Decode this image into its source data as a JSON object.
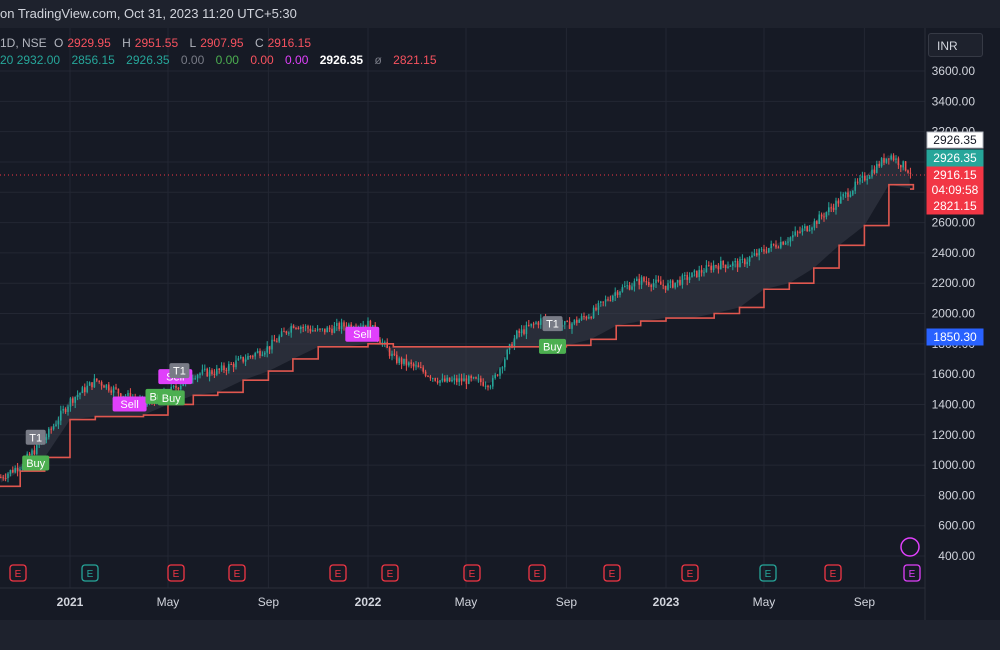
{
  "header": {
    "source_text": "on TradingView.com, Oct 31, 2023 11:20 UTC+5:30"
  },
  "legend": {
    "symbol": "1D, NSE",
    "o_label": "O",
    "o_val": "2929.95",
    "h_label": "H",
    "h_val": "2951.55",
    "l_label": "L",
    "l_val": "2907.95",
    "c_label": "C",
    "c_val": "2916.15",
    "ind_prefix": "20",
    "ind_values": [
      "2932.00",
      "2856.15",
      "2926.35",
      "0.00",
      "0.00",
      "0.00",
      "0.00",
      "2926.35",
      "2821.15"
    ],
    "ind_sep": "ø"
  },
  "price_axis": {
    "currency": "INR"
  },
  "price_tags": {
    "white": "2926.35",
    "green": "2926.35",
    "last_price": "2916.15",
    "countdown": "04:09:58",
    "stop": "2821.15",
    "blue": "1850.30"
  },
  "colors": {
    "bg": "#161a25",
    "grid": "#232733",
    "up": "#26a69a",
    "down": "#ef5350",
    "trail": "#e0574f",
    "label_buy": "#4caf50",
    "label_sell": "#e040fb",
    "label_t1": "#787b86",
    "blue_tag": "#2962ff"
  },
  "chart_data": {
    "type": "line",
    "description_series": "daily candlesticks with red trailing stop line and shaded band",
    "x": [
      "2020-10-01",
      "2020-11-01",
      "2020-12-01",
      "2021-01-01",
      "2021-02-01",
      "2021-03-01",
      "2021-04-01",
      "2021-05-01",
      "2021-06-01",
      "2021-07-01",
      "2021-08-01",
      "2021-09-01",
      "2021-10-01",
      "2021-11-01",
      "2021-12-01",
      "2022-01-01",
      "2022-02-01",
      "2022-03-01",
      "2022-04-01",
      "2022-05-01",
      "2022-06-01",
      "2022-07-01",
      "2022-08-01",
      "2022-09-01",
      "2022-10-01",
      "2022-11-01",
      "2022-12-01",
      "2023-01-01",
      "2023-02-01",
      "2023-03-01",
      "2023-04-01",
      "2023-05-01",
      "2023-06-01",
      "2023-07-01",
      "2023-08-01",
      "2023-09-01",
      "2023-10-01",
      "2023-10-31"
    ],
    "series": [
      {
        "values": [
          900,
          1000,
          1180,
          1430,
          1560,
          1480,
          1400,
          1480,
          1600,
          1620,
          1700,
          1780,
          1930,
          1880,
          1920,
          1930,
          1700,
          1640,
          1550,
          1560,
          1540,
          1860,
          1960,
          1920,
          2000,
          2150,
          2220,
          2180,
          2250,
          2320,
          2330,
          2420,
          2500,
          2600,
          2750,
          2900,
          3050,
          2916
        ]
      },
      {
        "values": [
          860,
          960,
          1050,
          1300,
          1320,
          1320,
          1330,
          1400,
          1460,
          1480,
          1560,
          1620,
          1700,
          1780,
          1780,
          1800,
          1780,
          1780,
          1780,
          1780,
          1780,
          1780,
          1780,
          1790,
          1830,
          1920,
          1950,
          1970,
          1970,
          2000,
          2040,
          2160,
          2200,
          2300,
          2450,
          2580,
          2850,
          2821
        ]
      }
    ],
    "ylim": [
      300,
      3720
    ],
    "y_ticks": [
      "3600.00",
      "3400.00",
      "3200.00",
      "3000.00",
      "2800.00",
      "2600.00",
      "2400.00",
      "2200.00",
      "2000.00",
      "1800.00",
      "1600.00",
      "1400.00",
      "1200.00",
      "1000.00",
      "800.00",
      "600.00",
      "400.00"
    ],
    "x_ticks": [
      "2021",
      "May",
      "Sep",
      "2022",
      "May",
      "Sep",
      "2023",
      "May",
      "Sep"
    ],
    "signals": [
      {
        "text": "T1",
        "x": "2020-11-20",
        "y": 1180
      },
      {
        "text": "Buy",
        "x": "2020-11-20",
        "y": 1010
      },
      {
        "text": "Sell",
        "x": "2021-03-15",
        "y": 1400
      },
      {
        "text": "Buy",
        "x": "2021-04-20",
        "y": 1450
      },
      {
        "text": "Buy",
        "x": "2021-05-05",
        "y": 1440
      },
      {
        "text": "Sell",
        "x": "2021-05-10",
        "y": 1580
      },
      {
        "text": "T1",
        "x": "2021-05-15",
        "y": 1620
      },
      {
        "text": "Sell",
        "x": "2021-12-25",
        "y": 1860
      },
      {
        "text": "T1",
        "x": "2022-08-15",
        "y": 1930
      },
      {
        "text": "Buy",
        "x": "2022-08-15",
        "y": 1780
      }
    ],
    "earnings_markers": [
      "E",
      "E",
      "E",
      "E",
      "E",
      "E",
      "E",
      "E",
      "E",
      "E",
      "E",
      "E",
      "E",
      "E",
      "E"
    ]
  }
}
